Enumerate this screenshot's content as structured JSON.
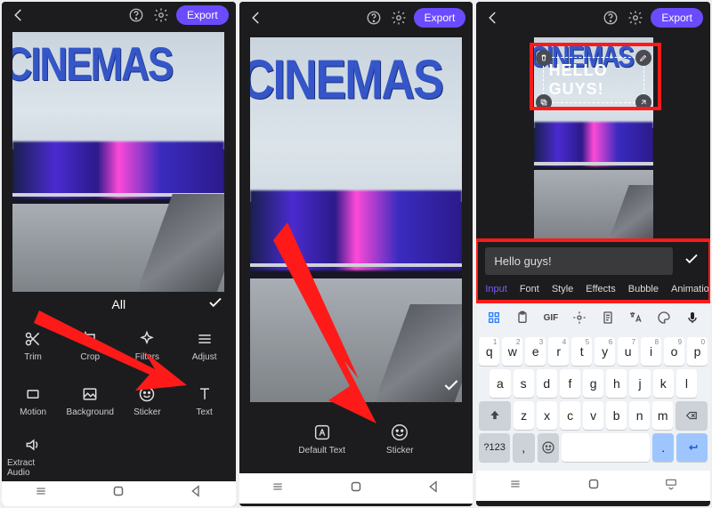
{
  "export_label": "Export",
  "category_all": "All",
  "tools": [
    {
      "icon": "scissors",
      "label": "Trim"
    },
    {
      "icon": "crop",
      "label": "Crop"
    },
    {
      "icon": "sparkle",
      "label": "Filters"
    },
    {
      "icon": "sliders",
      "label": "Adjust"
    },
    {
      "icon": "motion",
      "label": "Motion"
    },
    {
      "icon": "image",
      "label": "Background"
    },
    {
      "icon": "smile",
      "label": "Sticker"
    },
    {
      "icon": "text",
      "label": "Text"
    },
    {
      "icon": "audio",
      "label": "Extract Audio"
    }
  ],
  "cinema_sign": "CINEMAS",
  "phone2_actions": [
    {
      "icon": "A",
      "label": "Default Text"
    },
    {
      "icon": "smile",
      "label": "Sticker"
    }
  ],
  "overlay_text": "HELLO GUYS!",
  "input_value": "Hello guys!",
  "text_tabs": [
    "Input",
    "Font",
    "Style",
    "Effects",
    "Bubble",
    "Animation"
  ],
  "kb_suggestions_icons": [
    "grid",
    "clip",
    "gif",
    "settings",
    "doc",
    "translate",
    "palette",
    "mic"
  ],
  "kb_row1": [
    [
      "q",
      "1"
    ],
    [
      "w",
      "2"
    ],
    [
      "e",
      "3"
    ],
    [
      "r",
      "4"
    ],
    [
      "t",
      "5"
    ],
    [
      "y",
      "6"
    ],
    [
      "u",
      "7"
    ],
    [
      "i",
      "8"
    ],
    [
      "o",
      "9"
    ],
    [
      "p",
      "0"
    ]
  ],
  "kb_row2": [
    "a",
    "s",
    "d",
    "f",
    "g",
    "h",
    "j",
    "k",
    "l"
  ],
  "kb_row3": [
    "z",
    "x",
    "c",
    "v",
    "b",
    "n",
    "m"
  ],
  "kb_sym": "?123",
  "kb_comma": ",",
  "kb_period": "."
}
